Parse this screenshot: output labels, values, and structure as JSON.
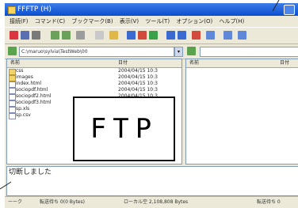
{
  "window": {
    "title": "FFFTP (H)"
  },
  "menu": {
    "items": [
      "接続(F)",
      "コマンド(C)",
      "ブックマーク(B)",
      "表示(V)",
      "ツール(T)",
      "オプション(O)",
      "ヘルプ(H)"
    ]
  },
  "address": {
    "local_path": "C:\\maruo\\sylvia\\TestWeb\\00"
  },
  "left_table": {
    "headers": {
      "name": "名前",
      "date": "日付"
    },
    "rows": [
      {
        "name": "css",
        "date": "2004/04/15 10:3",
        "type": "folder"
      },
      {
        "name": "images",
        "date": "2004/04/15 10:3",
        "type": "folder"
      },
      {
        "name": "index.html",
        "date": "2004/04/15 10:3",
        "type": "file"
      },
      {
        "name": "sociopdf.html",
        "date": "2004/04/15 10:3",
        "type": "file"
      },
      {
        "name": "sociopdf2.html",
        "date": "2004/04/15 10:3",
        "type": "file"
      },
      {
        "name": "sociopdf3.html",
        "date": "2004/04/15 10:3",
        "type": "file"
      },
      {
        "name": "sp.xls",
        "date": "",
        "type": "file"
      },
      {
        "name": "sp.csv",
        "date": "",
        "type": "file"
      }
    ]
  },
  "right_table": {
    "headers": {
      "name": "名前",
      "date": "日付"
    }
  },
  "log": {
    "message": "切断しました"
  },
  "status": {
    "left": "ーーク",
    "transfer": "転送待ち 0(0 Bytes)",
    "local": "ローカル空 2,108,808 Bytes",
    "right": "転送待ち 0"
  },
  "overlay": {
    "label": "FTP"
  }
}
